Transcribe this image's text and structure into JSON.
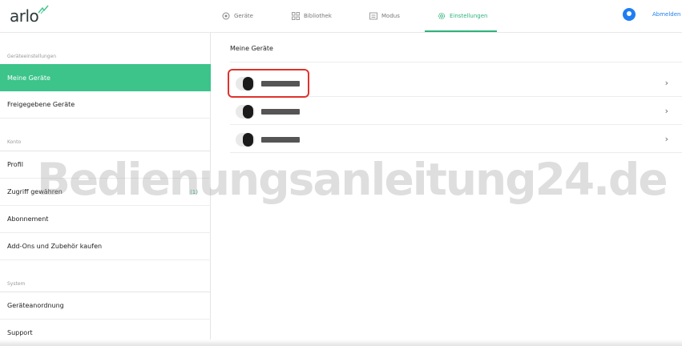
{
  "app": {
    "logo_text": "arlo",
    "accent_color": "#2db37a",
    "highlight_color": "#e0322b"
  },
  "nav": {
    "items": [
      {
        "label": "Geräte",
        "icon": "camera-icon",
        "active": false
      },
      {
        "label": "Bibliothek",
        "icon": "grid-icon",
        "active": false
      },
      {
        "label": "Modus",
        "icon": "mode-icon",
        "active": false
      },
      {
        "label": "Einstellungen",
        "icon": "gear-icon",
        "active": true
      }
    ],
    "logout_label": "Abmelden"
  },
  "sidebar": {
    "sections": [
      {
        "label": "Geräteeinstellungen"
      },
      {
        "label": "Konto"
      },
      {
        "label": "System"
      }
    ],
    "items": [
      {
        "label": "Meine Geräte",
        "active": true
      },
      {
        "label": "Freigegebene Geräte"
      },
      {
        "label": "Profil"
      },
      {
        "label": "Zugriff gewähren",
        "badge": "(1)"
      },
      {
        "label": "Abonnement"
      },
      {
        "label": "Add-Ons und Zubehör kaufen"
      },
      {
        "label": "Geräteanordnung"
      },
      {
        "label": "Support"
      }
    ]
  },
  "main": {
    "title": "Meine Geräte",
    "devices": [
      {
        "name": "",
        "icon": "camera-icon"
      },
      {
        "name": "",
        "icon": "camera-icon"
      },
      {
        "name": "",
        "icon": "camera-icon"
      }
    ],
    "chevron": "›"
  },
  "watermark": "Bedienungsanleitung24.de"
}
